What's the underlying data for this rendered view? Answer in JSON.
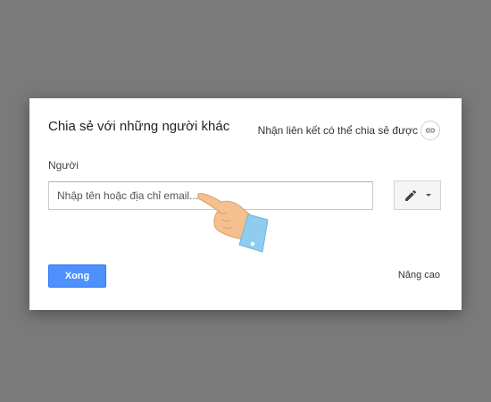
{
  "dialog": {
    "title": "Chia sẻ với những người khác",
    "share_link_label": "Nhận liên kết có thể chia sẻ được",
    "share_link_icon": "link-icon",
    "people_label": "Người",
    "email_input": {
      "placeholder": "Nhập tên hoặc địa chỉ email...",
      "value": ""
    },
    "permission_icon": "pencil-icon",
    "done_label": "Xong",
    "advanced_label": "Nâng cao"
  },
  "colors": {
    "overlay": "#7a7a7a",
    "primary_button": "#4d90fe",
    "hand_skin": "#f3c08e",
    "cuff": "#8ecdf0"
  }
}
